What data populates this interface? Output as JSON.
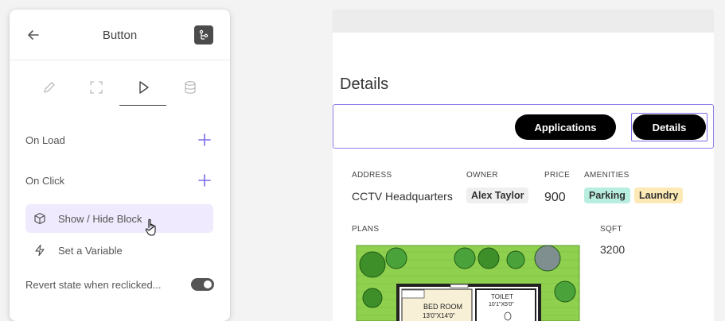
{
  "panel": {
    "title": "Button",
    "back_icon": "arrow-left-icon",
    "tree_icon": "component-tree-icon",
    "tabs": [
      {
        "icon": "pencil-icon",
        "active": false
      },
      {
        "icon": "expand-icon",
        "active": false
      },
      {
        "icon": "play-icon",
        "active": true
      },
      {
        "icon": "database-icon",
        "active": false
      }
    ],
    "on_load_label": "On Load",
    "on_click_label": "On Click",
    "actions": [
      {
        "label": "Show / Hide Block",
        "icon": "cube-icon",
        "selected": true
      },
      {
        "label": "Set a Variable",
        "icon": "lightning-icon",
        "selected": false
      }
    ],
    "revert_label": "Revert state when reclicked...",
    "revert_enabled": true
  },
  "canvas": {
    "heading": "Details",
    "buttons": [
      "Applications",
      "Details"
    ],
    "fields": {
      "address_label": "ADDRESS",
      "address_value": "CCTV Headquarters",
      "owner_label": "OWNER",
      "owner_value": "Alex Taylor",
      "price_label": "PRICE",
      "price_value": "900",
      "amenities_label": "AMENITIES",
      "amenities": [
        "Parking",
        "Laundry"
      ],
      "plans_label": "PLANS",
      "sqft_label": "SQFT",
      "sqft_value": "3200"
    },
    "plan_image": {
      "room_1": "BED ROOM",
      "room_1_size": "13'0\"X14'0\"",
      "room_2": "TOILET",
      "room_2_size": "10'1\"X5'0\""
    }
  },
  "colors": {
    "accent": "#7b6ce6",
    "selected_bg": "#efeafd",
    "parking_chip": "#b8eedf",
    "laundry_chip": "#fde9b5",
    "lawn": "#8fd14f"
  }
}
